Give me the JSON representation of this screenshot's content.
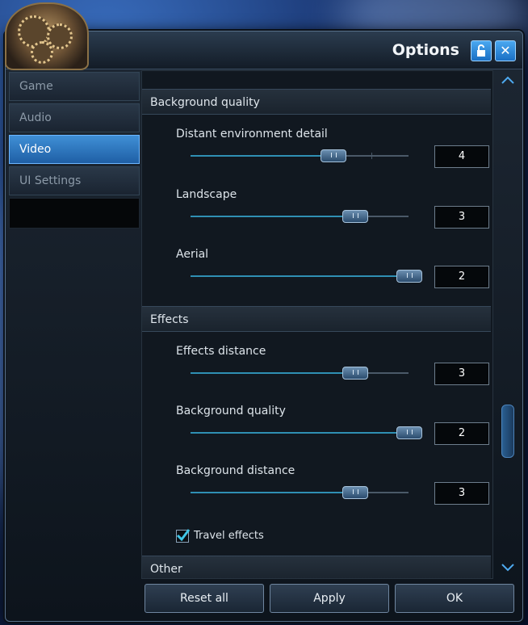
{
  "window": {
    "title": "Options"
  },
  "sidebar": {
    "items": [
      {
        "label": "Game"
      },
      {
        "label": "Audio"
      },
      {
        "label": "Video",
        "active": true
      },
      {
        "label": "UI Settings"
      }
    ]
  },
  "sections": {
    "background": {
      "header": "Background quality",
      "distant": {
        "label": "Distant environment detail",
        "value": "4",
        "level": 0.65
      },
      "landscape": {
        "label": "Landscape",
        "value": "3",
        "level": 0.75
      },
      "aerial": {
        "label": "Aerial",
        "value": "2",
        "level": 1.0
      }
    },
    "effects": {
      "header": "Effects",
      "effects_distance": {
        "label": "Effects distance",
        "value": "3",
        "level": 0.75
      },
      "bg_quality": {
        "label": "Background quality",
        "value": "2",
        "level": 1.0
      },
      "bg_distance": {
        "label": "Background distance",
        "value": "3",
        "level": 0.75
      },
      "travel_effects": {
        "label": "Travel effects",
        "checked": true
      }
    },
    "other": {
      "header": "Other"
    }
  },
  "footer": {
    "reset_label": "Reset all",
    "apply_label": "Apply",
    "ok_label": "OK"
  },
  "colors": {
    "accent": "#2f8fb3",
    "active_tab": "#3f8fd6",
    "check": "#3fc6e8"
  },
  "icons": {
    "lock": "lock-icon",
    "close": "close-icon",
    "scroll_up": "chevron-up-icon",
    "scroll_down": "chevron-down-icon",
    "check": "checkmark-icon",
    "emblem": "gear-emblem-icon"
  }
}
